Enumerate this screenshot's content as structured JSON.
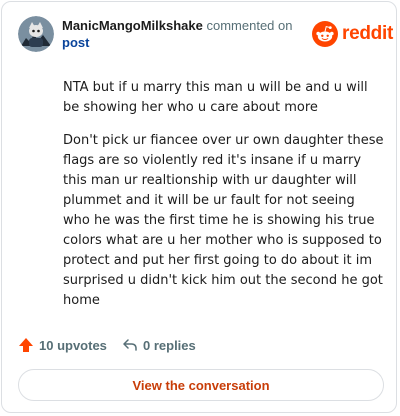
{
  "header": {
    "username": "ManicMangoMilkshake",
    "action_text": " commented on",
    "post_link": "post"
  },
  "brand": {
    "wordmark": "reddit",
    "icon": "reddit-logo-icon",
    "color": "#ff4500"
  },
  "comment": {
    "paragraphs": [
      "NTA but if u marry this man u will be and u will be showing her who u care about more",
      "Don't pick ur fiancee over ur own daughter these flags are so violently red it's insane if u marry this man ur realtionship with ur daughter will plummet and it will be ur fault for not seeing who he was the first time he is showing his true colors what are u her mother who is supposed to protect and put her first going to do about it im surprised u didn't kick him out the second he got home"
    ]
  },
  "actions": {
    "upvotes_label": "10 upvotes",
    "upvote_icon": "upvote-arrow-icon",
    "upvote_color": "#ff4500",
    "replies_label": "0 replies",
    "reply_icon": "reply-icon"
  },
  "footer": {
    "button_label": "View the conversation"
  }
}
